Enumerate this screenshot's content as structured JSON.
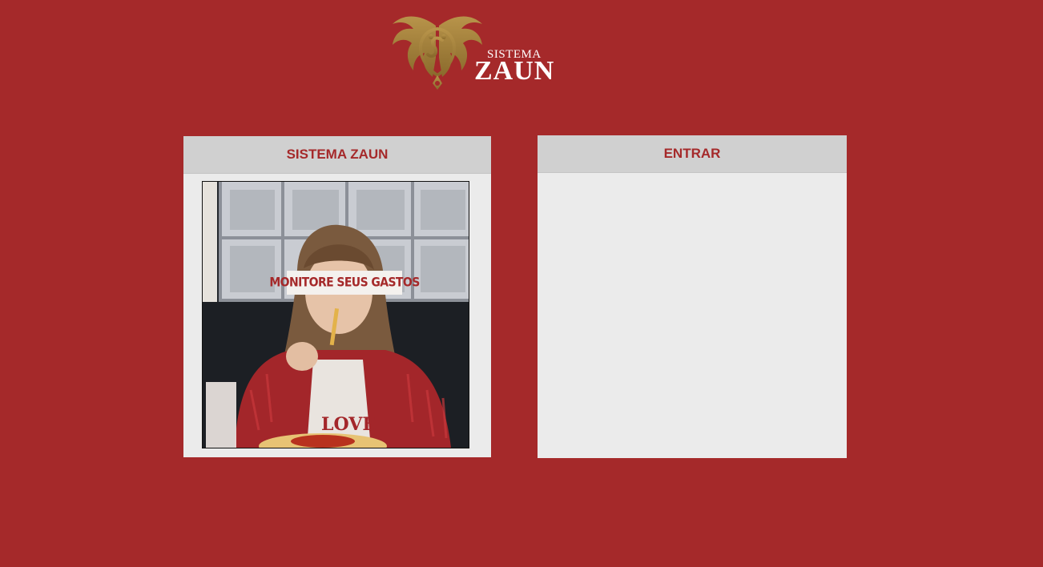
{
  "logo": {
    "small_text": "SISTEMA",
    "big_text": "ZAUN",
    "emblem_icon": "dragon-emblem-icon"
  },
  "colors": {
    "background": "#a5292a",
    "panel": "#ebebeb",
    "panel_header": "#d0d0d0",
    "accent_text": "#a5292a",
    "logo_gold": "#a0803a"
  },
  "panels": {
    "left": {
      "title": "SISTEMA ZAUN",
      "image_caption": "MONITORE SEUS GASTOS",
      "image_shirt_text": "LOVE"
    },
    "right": {
      "title": "ENTRAR"
    }
  }
}
